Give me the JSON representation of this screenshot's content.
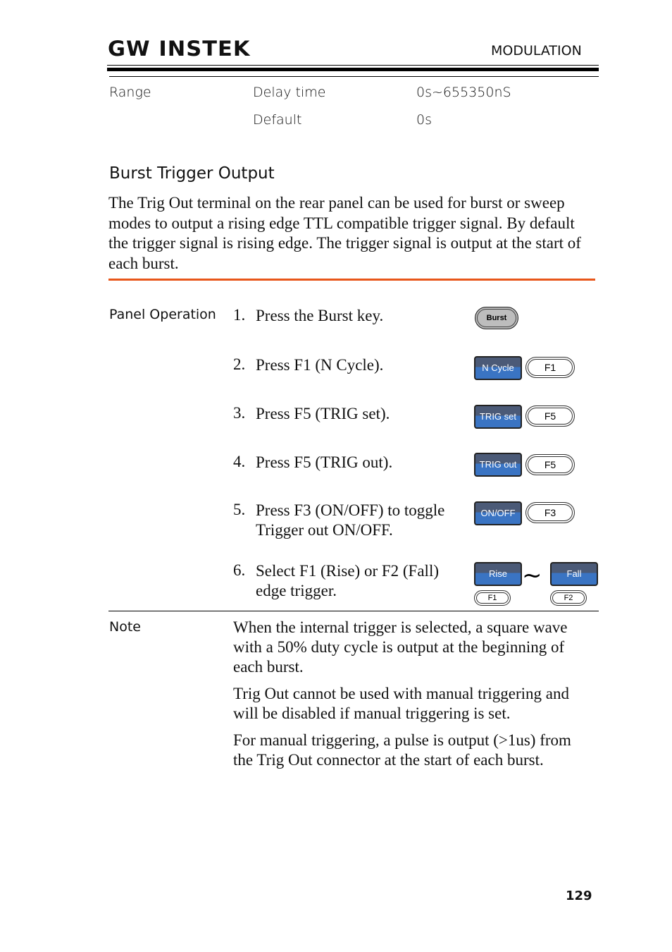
{
  "header": {
    "brand_logo": "GW INSTEK",
    "section": "MODULATION"
  },
  "spec_table": {
    "label": "Range",
    "rows": [
      {
        "name": "Delay time",
        "value": "0s~655350nS"
      },
      {
        "name": "Default",
        "value": "0s"
      }
    ]
  },
  "section": {
    "heading": "Burst Trigger Output",
    "description": " The Trig Out terminal on the rear panel can be used for burst or sweep modes to output a rising edge TTL compatible trigger signal. By default the trigger signal is rising edge. The trigger signal is output at the start of each burst.",
    "accent_color": "#e8561a"
  },
  "panel_operation": {
    "label": "Panel Operation",
    "steps": [
      {
        "num": "1.",
        "text": "Press the Burst key.",
        "key": "Burst"
      },
      {
        "num": "2.",
        "text": "Press F1 (N Cycle).",
        "softkey": "N Cycle",
        "fkey": "F1"
      },
      {
        "num": "3.",
        "text": "Press F5 (TRIG set).",
        "softkey": "TRIG set",
        "fkey": "F5"
      },
      {
        "num": "4.",
        "text": "Press F5 (TRIG out).",
        "softkey": "TRIG out",
        "fkey": "F5"
      },
      {
        "num": "5.",
        "text": "Press F3 (ON/OFF) to toggle Trigger out ON/OFF.",
        "softkey": "ON/OFF",
        "fkey": "F3"
      },
      {
        "num": "6.",
        "text": "Select F1 (Rise) or F2 (Fall) edge trigger.",
        "softkey_a": "Rise",
        "fkey_a": "F1",
        "separator": "~",
        "softkey_b": "Fall",
        "fkey_b": "F2"
      }
    ]
  },
  "note": {
    "label": "Note",
    "paragraphs": [
      "When the internal trigger is selected, a square wave with a 50% duty cycle is output at the beginning of each burst.",
      "Trig Out cannot be used with manual triggering and will be disabled if manual triggering is set.",
      "For manual triggering, a pulse is output (>1us) from the Trig Out connector at the start of each burst."
    ]
  },
  "footer": {
    "page_number": "129"
  }
}
